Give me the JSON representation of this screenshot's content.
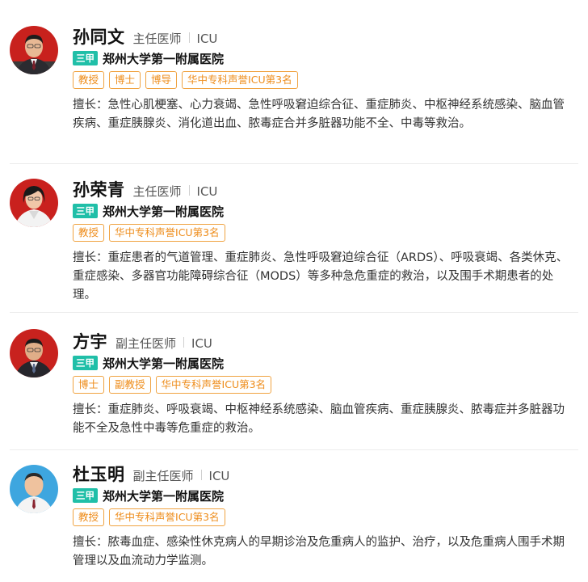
{
  "doctors": [
    {
      "name": "孙同文",
      "title": "主任医师",
      "department": "ICU",
      "level_badge": "三甲",
      "hospital": "郑州大学第一附属医院",
      "tags": [
        "教授",
        "博士",
        "博导",
        "华中专科声誉ICU第3名"
      ],
      "skill": "擅长：急性心肌梗塞、心力衰竭、急性呼吸窘迫综合征、重症肺炎、中枢神经系统感染、脑血管疾病、重症胰腺炎、消化道出血、脓毒症合并多脏器功能不全、中毒等救治。"
    },
    {
      "name": "孙荣青",
      "title": "主任医师",
      "department": "ICU",
      "level_badge": "三甲",
      "hospital": "郑州大学第一附属医院",
      "tags": [
        "教授",
        "华中专科声誉ICU第3名"
      ],
      "skill": "擅长：重症患者的气道管理、重症肺炎、急性呼吸窘迫综合征（ARDS）、呼吸衰竭、各类休克、重症感染、多器官功能障碍综合征（MODS）等多种急危重症的救治，以及围手术期患者的处理。"
    },
    {
      "name": "方宇",
      "title": "副主任医师",
      "department": "ICU",
      "level_badge": "三甲",
      "hospital": "郑州大学第一附属医院",
      "tags": [
        "博士",
        "副教授",
        "华中专科声誉ICU第3名"
      ],
      "skill": "擅长：重症肺炎、呼吸衰竭、中枢神经系统感染、脑血管疾病、重症胰腺炎、脓毒症并多脏器功能不全及急性中毒等危重症的救治。"
    },
    {
      "name": "杜玉明",
      "title": "副主任医师",
      "department": "ICU",
      "level_badge": "三甲",
      "hospital": "郑州大学第一附属医院",
      "tags": [
        "教授",
        "华中专科声誉ICU第3名"
      ],
      "skill": "擅长：脓毒血症、感染性休克病人的早期诊治及危重病人的监护、治疗，以及危重病人围手术期管理以及血流动力学监测。"
    }
  ]
}
